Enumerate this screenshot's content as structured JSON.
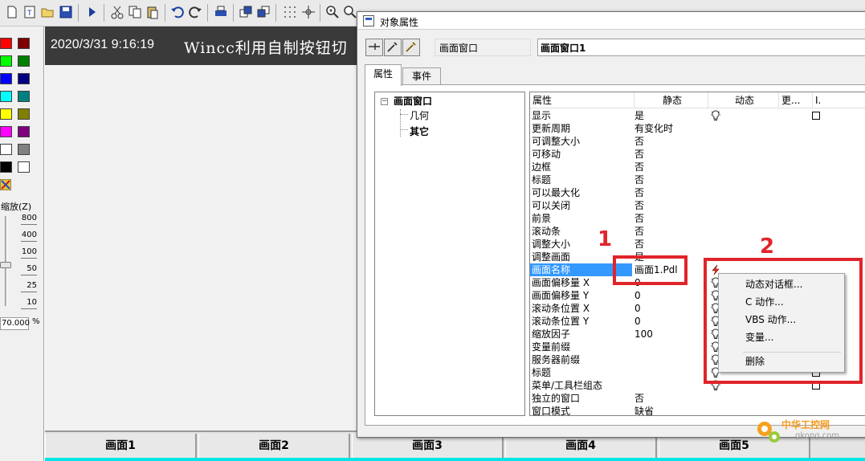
{
  "toolbar": {
    "icons": [
      "new-file-icon",
      "text-file-icon",
      "open-folder-icon",
      "save-icon",
      "play-icon",
      "cut-icon",
      "copy-icon",
      "paste-icon",
      "undo-icon",
      "redo-icon",
      "print-icon",
      "bring-front-icon",
      "send-back-icon",
      "grid-icon",
      "snap-icon",
      "zoom-in-icon",
      "zoom-out-icon"
    ]
  },
  "palette": {
    "colors": [
      "#ff0000",
      "#800000",
      "#00ff00",
      "#008000",
      "#0000ff",
      "#000080",
      "#00ffff",
      "#008080",
      "#ffff00",
      "#808000",
      "#ff00ff",
      "#800080",
      "#ffffff",
      "#808080",
      "#000000",
      "#ffffff"
    ],
    "zoom_label": "缩放(Z)",
    "zoom_options": [
      "800",
      "400",
      "100",
      "50",
      "25",
      "10"
    ],
    "zoom_value": "70.000",
    "zoom_unit": "%"
  },
  "canvas": {
    "datetime": "2020/3/31 9:16:19",
    "title": "Wincc利用自制按钮切",
    "bottom_buttons": [
      "画面1",
      "画面2",
      "画面3",
      "画面4",
      "画面5"
    ]
  },
  "dialog": {
    "title": "对象属性",
    "object_type": "画面窗口",
    "object_name": "画面窗口1",
    "tabs": [
      "属性",
      "事件"
    ],
    "tree": {
      "root": "画面窗口",
      "children": [
        "几何",
        "其它"
      ]
    },
    "grid": {
      "headers": [
        "属性",
        "静态",
        "动态",
        "更...",
        "I."
      ],
      "rows": [
        {
          "attr": "显示",
          "static": "是"
        },
        {
          "attr": "更新周期",
          "static": "有变化时"
        },
        {
          "attr": "可调整大小",
          "static": "否"
        },
        {
          "attr": "可移动",
          "static": "否"
        },
        {
          "attr": "边框",
          "static": "否"
        },
        {
          "attr": "标题",
          "static": "否"
        },
        {
          "attr": "可以最大化",
          "static": "否"
        },
        {
          "attr": "可以关闭",
          "static": "否"
        },
        {
          "attr": "前景",
          "static": "否"
        },
        {
          "attr": "滚动条",
          "static": "否"
        },
        {
          "attr": "调整大小",
          "static": "否"
        },
        {
          "attr": "调整画面",
          "static": "是"
        },
        {
          "attr": "画面名称",
          "static": "画面1.Pdl"
        },
        {
          "attr": "画面偏移量 X",
          "static": "0"
        },
        {
          "attr": "画面偏移量 Y",
          "static": "0"
        },
        {
          "attr": "滚动条位置 X",
          "static": "0"
        },
        {
          "attr": "滚动条位置 Y",
          "static": "0"
        },
        {
          "attr": "缩放因子",
          "static": "100"
        },
        {
          "attr": "变量前缀",
          "static": ""
        },
        {
          "attr": "服务器前缀",
          "static": ""
        },
        {
          "attr": "标题",
          "static": ""
        },
        {
          "attr": "菜单/工具栏组态",
          "static": ""
        },
        {
          "attr": "独立的窗口",
          "static": "否"
        },
        {
          "attr": "窗口模式",
          "static": "缺省"
        }
      ]
    }
  },
  "annotations": {
    "label1": "1",
    "label2": "2"
  },
  "context_menu": {
    "items": [
      "动态对话框...",
      "C 动作...",
      "VBS 动作...",
      "变量...",
      "删除"
    ]
  },
  "watermark": {
    "line1": "中华工控网",
    "line2": "gkong.com"
  }
}
